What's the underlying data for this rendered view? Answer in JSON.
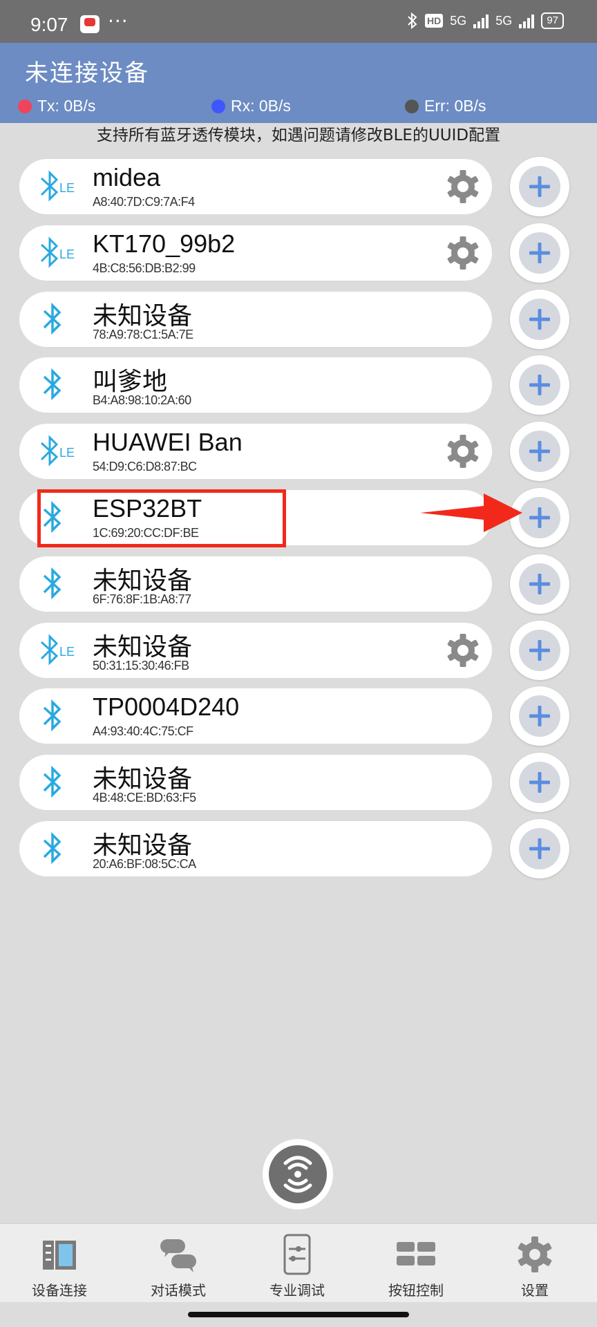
{
  "status_bar": {
    "time": "9:07",
    "more": "···",
    "hd": "HD",
    "net1": "5G",
    "net2": "5G",
    "battery": "97"
  },
  "header": {
    "title": "未连接设备",
    "tx": {
      "label": "Tx: 0B/s",
      "color": "#f0445a"
    },
    "rx": {
      "label": "Rx: 0B/s",
      "color": "#3f56ff"
    },
    "err": {
      "label": "Err: 0B/s",
      "color": "#555555"
    }
  },
  "hint": "支持所有蓝牙透传模块，如遇问题请修改BLE的UUID配置",
  "devices": [
    {
      "name": "midea",
      "mac": "A8:40:7D:C9:7A:F4",
      "type": "ble",
      "settings": true
    },
    {
      "name": "KT170_99b2",
      "mac": "4B:C8:56:DB:B2:99",
      "type": "ble",
      "settings": true
    },
    {
      "name": "未知设备",
      "mac": "78:A9:78:C1:5A:7E",
      "type": "classic",
      "settings": false
    },
    {
      "name": "叫爹地",
      "mac": "B4:A8:98:10:2A:60",
      "type": "classic",
      "settings": false
    },
    {
      "name": "HUAWEI Ban",
      "mac": "54:D9:C6:D8:87:BC",
      "type": "ble",
      "settings": true
    },
    {
      "name": "ESP32BT",
      "mac": "1C:69:20:CC:DF:BE",
      "type": "classic",
      "settings": false
    },
    {
      "name": "未知设备",
      "mac": "6F:76:8F:1B:A8:77",
      "type": "classic",
      "settings": false
    },
    {
      "name": "未知设备",
      "mac": "50:31:15:30:46:FB",
      "type": "ble",
      "settings": true
    },
    {
      "name": "TP0004D240",
      "mac": "A4:93:40:4C:75:CF",
      "type": "classic",
      "settings": false
    },
    {
      "name": "未知设备",
      "mac": "4B:48:CE:BD:63:F5",
      "type": "classic",
      "settings": false
    },
    {
      "name": "未知设备",
      "mac": "20:A6:BF:08:5C:CA",
      "type": "classic",
      "settings": false
    }
  ],
  "ble_badge": "LE",
  "nav": [
    {
      "label": "设备连接",
      "icon": "device-connect-icon"
    },
    {
      "label": "对话模式",
      "icon": "chat-icon"
    },
    {
      "label": "专业调试",
      "icon": "debug-icon"
    },
    {
      "label": "按钮控制",
      "icon": "button-grid-icon"
    },
    {
      "label": "设置",
      "icon": "gear-icon"
    }
  ],
  "colors": {
    "accent": "#6c8cc3",
    "bluetooth": "#29a9e1",
    "plus": "#5a8de0",
    "highlight": "#f2291a"
  }
}
